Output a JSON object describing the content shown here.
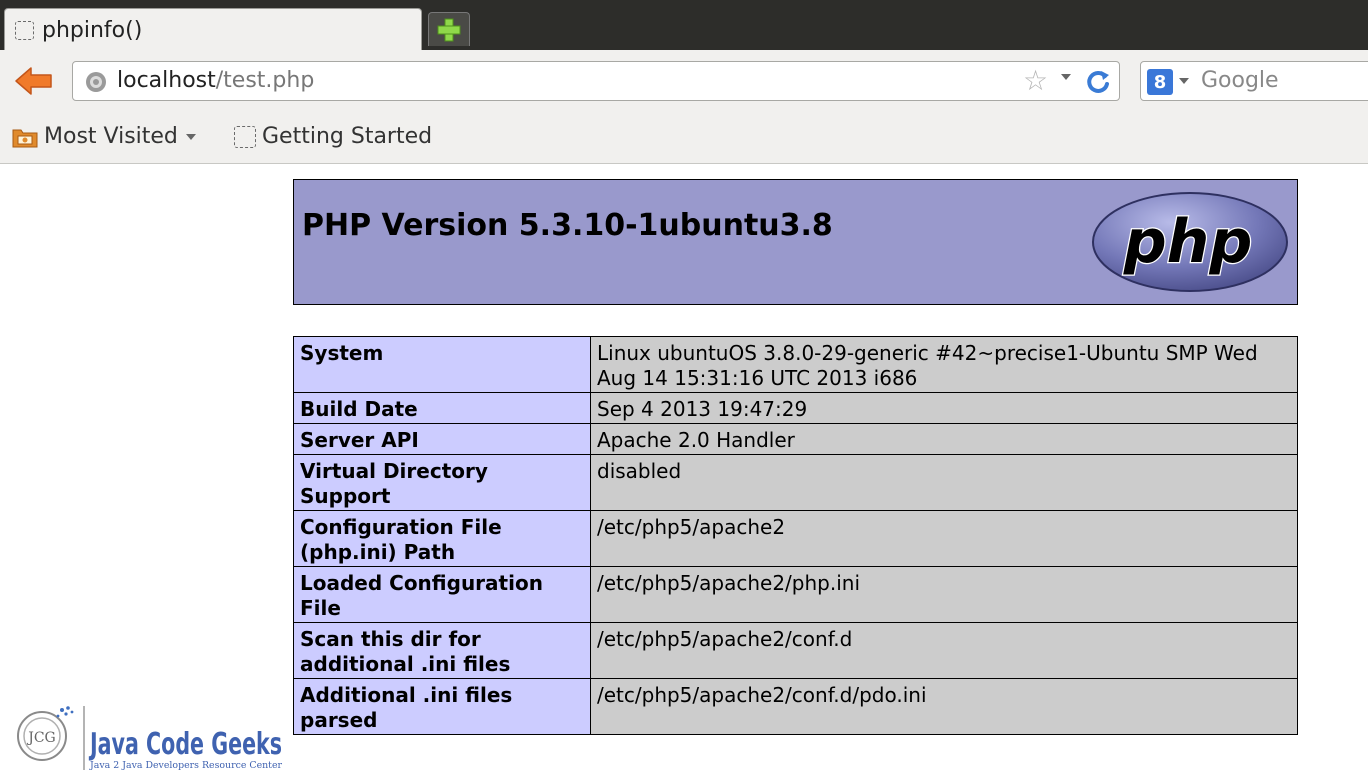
{
  "browser": {
    "tab": {
      "title": "phpinfo()"
    },
    "new_tab_icon": "plus-icon",
    "address": {
      "host": "localhost",
      "path": "/test.php"
    },
    "search": {
      "placeholder": "Google",
      "engine_icon": "google-plus-icon",
      "engine_letter": "8"
    },
    "bookmarks": [
      {
        "label": "Most Visited",
        "icon": "folder-icon",
        "has_dropdown": true
      },
      {
        "label": "Getting Started",
        "icon": "page-icon",
        "has_dropdown": false
      }
    ]
  },
  "phpinfo": {
    "version_title": "PHP Version 5.3.10-1ubuntu3.8",
    "logo_text": "php",
    "rows": [
      {
        "key": "System",
        "value": "Linux ubuntuOS 3.8.0-29-generic #42~precise1-Ubuntu SMP Wed Aug 14 15:31:16 UTC 2013 i686"
      },
      {
        "key": "Build Date",
        "value": "Sep 4 2013 19:47:29"
      },
      {
        "key": "Server API",
        "value": "Apache 2.0 Handler"
      },
      {
        "key": "Virtual Directory Support",
        "value": "disabled"
      },
      {
        "key": "Configuration File (php.ini) Path",
        "value": "/etc/php5/apache2"
      },
      {
        "key": "Loaded Configuration File",
        "value": "/etc/php5/apache2/php.ini"
      },
      {
        "key": "Scan this dir for additional .ini files",
        "value": "/etc/php5/apache2/conf.d"
      },
      {
        "key": "Additional .ini files parsed",
        "value": "/etc/php5/apache2/conf.d/pdo.ini"
      }
    ]
  },
  "watermark": {
    "name": "Java Code Geeks",
    "tagline": "Java 2 Java Developers Resource Center",
    "badge": "JCG"
  },
  "colors": {
    "php_header_bg": "#9999cc",
    "key_cell_bg": "#ccccff",
    "value_cell_bg": "#cccccc",
    "tabstrip_bg": "#2d2d2a",
    "toolbar_bg": "#f1f0ee"
  }
}
